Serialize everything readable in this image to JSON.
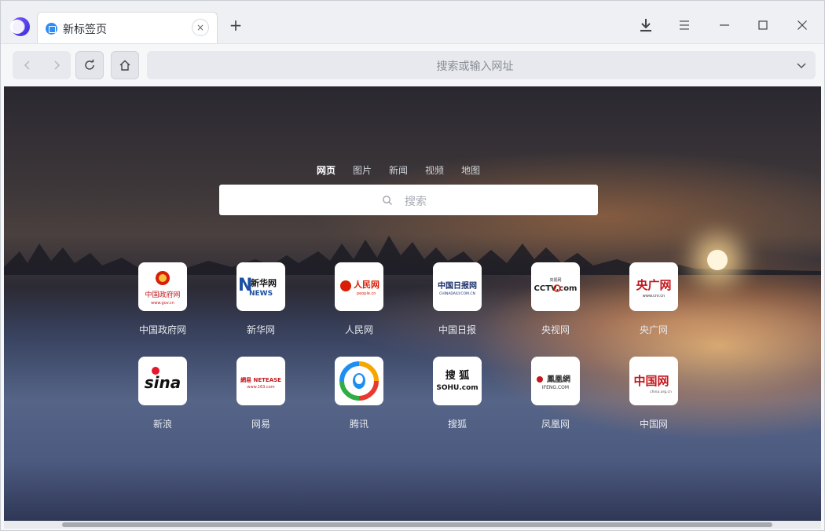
{
  "tab": {
    "title": "新标签页",
    "close": "×"
  },
  "new_tab_label": "+",
  "address": {
    "placeholder": "搜索或输入网址"
  },
  "search": {
    "tabs": [
      "网页",
      "图片",
      "新闻",
      "视频",
      "地图"
    ],
    "active_tab": "网页",
    "placeholder": "搜索"
  },
  "shortcuts": [
    {
      "label": "中国政府网",
      "logo_text": "中国政府网",
      "logo_sub": "www.gov.cn"
    },
    {
      "label": "新华网",
      "logo_text": "新华网",
      "logo_sub": "NEWS"
    },
    {
      "label": "人民网",
      "logo_text": "人民网",
      "logo_sub": "people.cn"
    },
    {
      "label": "中国日报",
      "logo_text": "中国日报网",
      "logo_sub": "CHINADAILY.COM.CN"
    },
    {
      "label": "央视网",
      "logo_text": "CCTV.com",
      "logo_sub": "央视网"
    },
    {
      "label": "央广网",
      "logo_text": "央广网",
      "logo_sub": "www.cnr.cn"
    },
    {
      "label": "新浪",
      "logo_text": "sina",
      "logo_sub": ""
    },
    {
      "label": "网易",
      "logo_text": "網易 NETEASE",
      "logo_sub": "www.163.com"
    },
    {
      "label": "腾讯",
      "logo_text": "",
      "logo_sub": ""
    },
    {
      "label": "搜狐",
      "logo_text": "搜 狐",
      "logo_sub": "SOHU.com"
    },
    {
      "label": "凤凰网",
      "logo_text": "鳳凰網",
      "logo_sub": "IFENG.COM"
    },
    {
      "label": "中国网",
      "logo_text": "中国网",
      "logo_sub": "china.org.cn"
    }
  ],
  "colors": {
    "accent": "#2f8cf5",
    "tab_bar": "#eef0f4",
    "toolbar": "#f6f7f9"
  }
}
